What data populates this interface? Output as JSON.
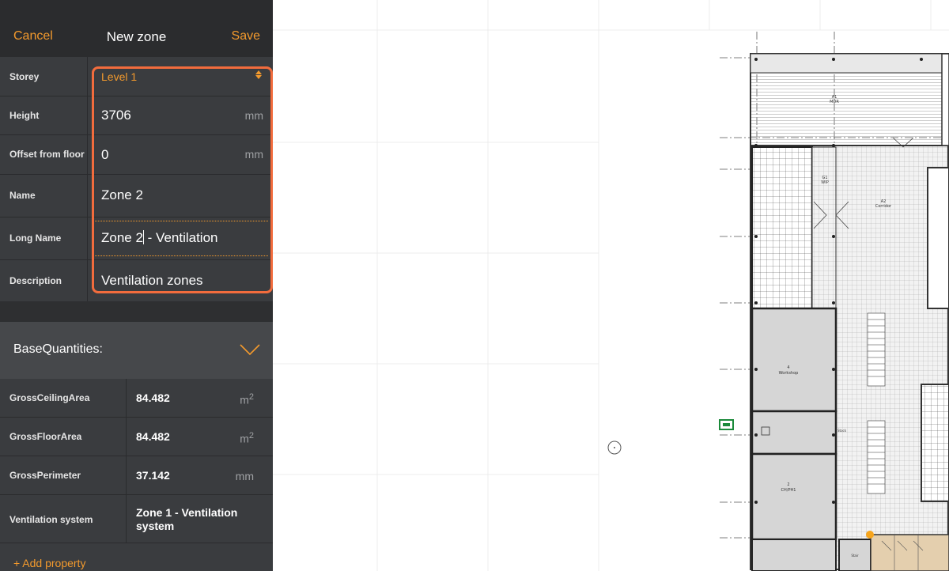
{
  "header": {
    "cancel_label": "Cancel",
    "title": "New zone",
    "save_label": "Save"
  },
  "form": {
    "storey": {
      "label": "Storey",
      "value": "Level 1"
    },
    "height": {
      "label": "Height",
      "value": "3706",
      "unit": "mm"
    },
    "offset": {
      "label": "Offset from floor",
      "value": "0",
      "unit": "mm"
    },
    "name": {
      "label": "Name",
      "value": "Zone 2"
    },
    "long_name": {
      "label": "Long Name",
      "value_before_cursor": "Zone 2",
      "value_after_cursor": " - Ventilation"
    },
    "description": {
      "label": "Description",
      "value": "Ventilation zones"
    }
  },
  "base_quantities": {
    "title": "BaseQuantities:",
    "rows": [
      {
        "label": "GrossCeilingArea",
        "value": "84.482",
        "unit": "m",
        "sup": "2"
      },
      {
        "label": "GrossFloorArea",
        "value": "84.482",
        "unit": "m",
        "sup": "2"
      },
      {
        "label": "GrossPerimeter",
        "value": "37.142",
        "unit": "mm",
        "sup": ""
      },
      {
        "label": "Ventilation system",
        "value_line1": "Zone 1 - Ventilation",
        "value_line2": "system"
      }
    ],
    "add_property": "+ Add property"
  },
  "floorplan": {
    "rooms": [
      {
        "number": "A1",
        "name": "MDR"
      },
      {
        "number": "G1",
        "name": "WIP"
      },
      {
        "number": "A2",
        "name": "Corridor"
      },
      {
        "number": "4",
        "name": "Workshop"
      },
      {
        "number": "2",
        "name": "CH/PH1"
      },
      {
        "number": "",
        "name": "Stock"
      },
      {
        "number": "",
        "name": "Stair"
      }
    ]
  },
  "colors": {
    "accent": "#f39a2d",
    "highlight": "#f26c3d",
    "panel_bg": "#3a3c3f",
    "topbar_bg": "#2b2c2e"
  }
}
